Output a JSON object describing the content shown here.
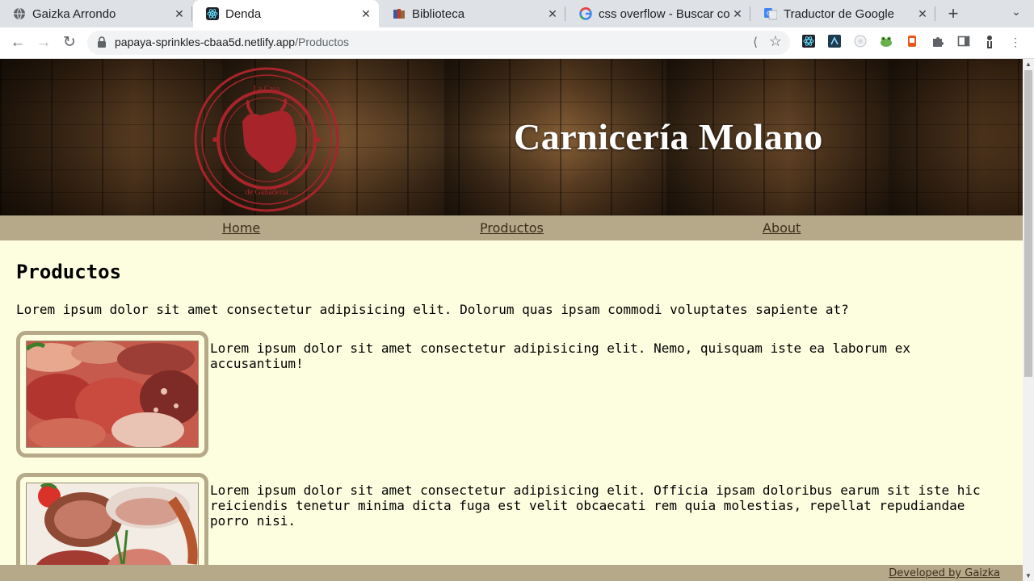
{
  "browser": {
    "tabs": [
      {
        "title": "Gaizka Arrondo",
        "icon": "globe-icon"
      },
      {
        "title": "Denda",
        "icon": "react-icon"
      },
      {
        "title": "Biblioteca",
        "icon": "books-icon"
      },
      {
        "title": "css overflow - Buscar con Google",
        "icon": "google-icon"
      },
      {
        "title": "Traductor de Google",
        "icon": "translate-icon"
      }
    ],
    "active_tab": 1,
    "url_host": "papaya-sprinkles-cbaa5d.netlify.app",
    "url_path": "/Productos",
    "extensions": [
      "react-devtools-icon",
      "ext-dark-icon",
      "ext-circle-icon",
      "frog-icon",
      "ext-orange-icon",
      "puzzle-icon",
      "sidepanel-icon",
      "profile-icon",
      "kebab-menu-icon"
    ]
  },
  "site": {
    "brand": "Carnicería Molano",
    "seal_text_top": "La Casa",
    "seal_text_bottom": "de Ganadería",
    "nav": {
      "home": "Home",
      "productos": "Productos",
      "about": "About"
    },
    "heading": "Productos",
    "intro": "Lorem ipsum dolor sit amet consectetur adipisicing elit. Dolorum quas ipsam commodi voluptates sapiente at?",
    "products": [
      {
        "text": "Lorem ipsum dolor sit amet consectetur adipisicing elit. Nemo, quisquam iste ea laborum ex accusantium!"
      },
      {
        "text": "Lorem ipsum dolor sit amet consectetur adipisicing elit. Officia ipsam doloribus earum sit iste hic reiciendis tenetur minima dicta fuga est velit obcaecati rem quia molestias, repellat repudiandae porro nisi."
      }
    ],
    "footer": "Developed by Gaizka"
  },
  "colors": {
    "page_bg": "#fdfee0",
    "nav_bg": "#b6a98a",
    "seal": "#a8242b"
  }
}
